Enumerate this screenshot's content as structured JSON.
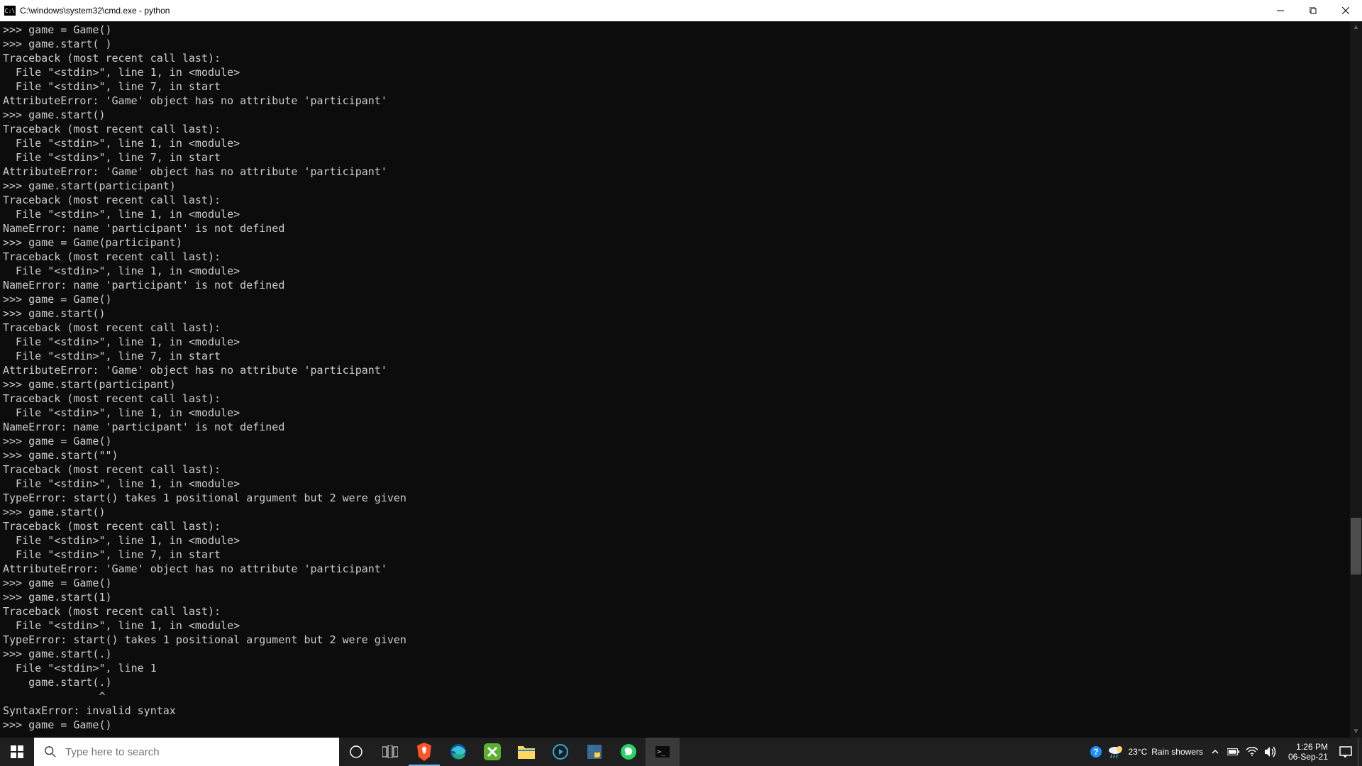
{
  "window": {
    "icon_text": "C:\\",
    "title": "C:\\windows\\system32\\cmd.exe - python"
  },
  "terminal": {
    "content": ">>> game = Game()\n>>> game.start( )\nTraceback (most recent call last):\n  File \"<stdin>\", line 1, in <module>\n  File \"<stdin>\", line 7, in start\nAttributeError: 'Game' object has no attribute 'participant'\n>>> game.start()\nTraceback (most recent call last):\n  File \"<stdin>\", line 1, in <module>\n  File \"<stdin>\", line 7, in start\nAttributeError: 'Game' object has no attribute 'participant'\n>>> game.start(participant)\nTraceback (most recent call last):\n  File \"<stdin>\", line 1, in <module>\nNameError: name 'participant' is not defined\n>>> game = Game(participant)\nTraceback (most recent call last):\n  File \"<stdin>\", line 1, in <module>\nNameError: name 'participant' is not defined\n>>> game = Game()\n>>> game.start()\nTraceback (most recent call last):\n  File \"<stdin>\", line 1, in <module>\n  File \"<stdin>\", line 7, in start\nAttributeError: 'Game' object has no attribute 'participant'\n>>> game.start(participant)\nTraceback (most recent call last):\n  File \"<stdin>\", line 1, in <module>\nNameError: name 'participant' is not defined\n>>> game = Game()\n>>> game.start(\"\")\nTraceback (most recent call last):\n  File \"<stdin>\", line 1, in <module>\nTypeError: start() takes 1 positional argument but 2 were given\n>>> game.start()\nTraceback (most recent call last):\n  File \"<stdin>\", line 1, in <module>\n  File \"<stdin>\", line 7, in start\nAttributeError: 'Game' object has no attribute 'participant'\n>>> game = Game()\n>>> game.start(1)\nTraceback (most recent call last):\n  File \"<stdin>\", line 1, in <module>\nTypeError: start() takes 1 positional argument but 2 were given\n>>> game.start(.)\n  File \"<stdin>\", line 1\n    game.start(.)\n               ^\nSyntaxError: invalid syntax\n>>> game = Game()"
  },
  "taskbar": {
    "search_placeholder": "Type here to search",
    "weather_temp": "23°C",
    "weather_text": "Rain showers",
    "time": "1:26 PM",
    "date": "06-Sep-21"
  }
}
